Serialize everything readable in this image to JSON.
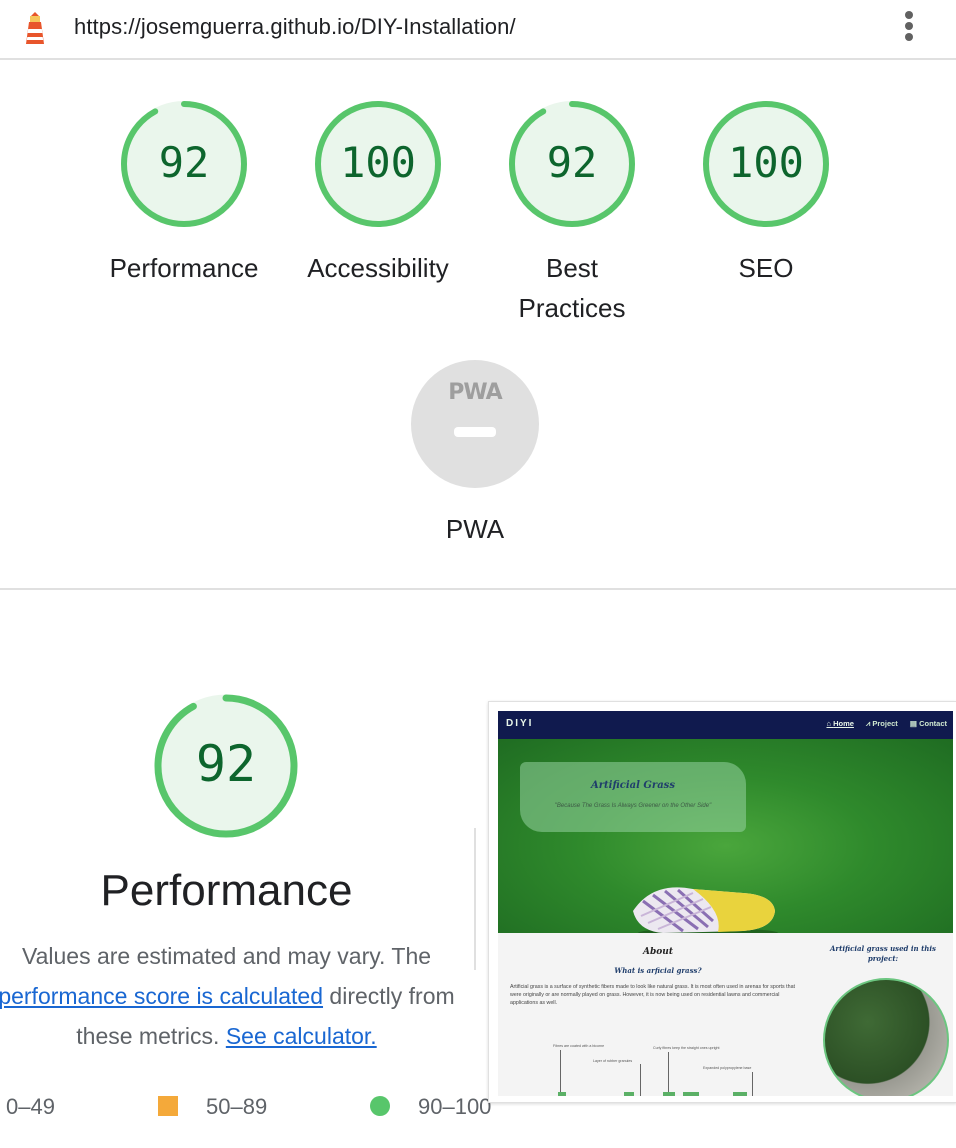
{
  "browser": {
    "url": "https://josemguerra.github.io/DIY-Installation/",
    "logo_icon": "lighthouse-icon",
    "menu_icon": "more-vert-icon"
  },
  "colors": {
    "pass": "#0d652d",
    "pass_ring": "#58c66b",
    "pass_fill": "#eaf6ec",
    "average": "#f4a93a",
    "neutral": "#e0e0e0",
    "link": "#1967d2"
  },
  "scores": [
    {
      "label": "Performance",
      "score": "92",
      "fraction": 0.92
    },
    {
      "label": "Accessibility",
      "score": "100",
      "fraction": 1.0
    },
    {
      "label": "Best Practices",
      "score": "92",
      "fraction": 0.92
    },
    {
      "label": "SEO",
      "score": "100",
      "fraction": 1.0
    }
  ],
  "pwa": {
    "badge_text": "PWA",
    "label": "PWA"
  },
  "performance": {
    "score": "92",
    "fraction": 0.92,
    "title": "Performance",
    "desc_part1": "Values are estimated and may vary. The",
    "link1": "performance score is calculated",
    "desc_part2": "directly from these metrics.",
    "link2": "See calculator."
  },
  "legend": {
    "fail": "0–49",
    "average": "50–89",
    "pass": "90–100"
  },
  "screenshot": {
    "brand": "DIYI",
    "nav": [
      "Home",
      "Project",
      "Contact"
    ],
    "hero_title": "Artificial Grass",
    "hero_subtitle": "\"Because The Grass Is Always Greener on the Other Side\"",
    "about_title": "About",
    "about_subtitle": "What is arficial grass?",
    "about_text": "Artificial grass is a surface of synthetic fibers made to look like natural grass. It is most often used in arenas for sports that were originally or are normally played on grass. However, it is now being used on residential lawns and commercial applications as well.",
    "side_title": "Artificial grass used in this project:",
    "diagram_labels": [
      "Fibres are coated with a bicorne",
      "Layer of rubber granules",
      "Curly fibres keep the straight ones upright",
      "Expanded polypropylene base"
    ]
  }
}
